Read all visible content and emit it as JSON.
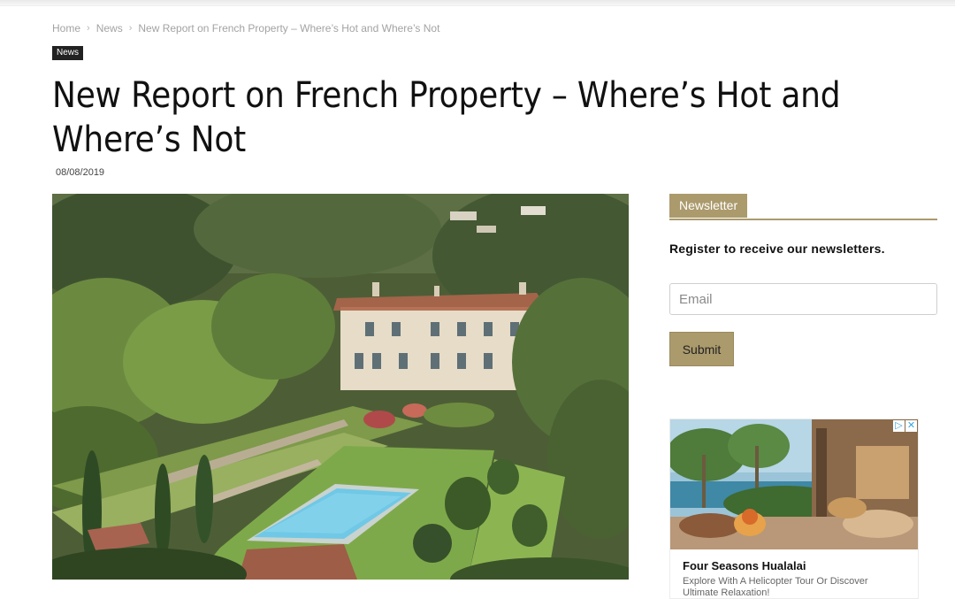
{
  "breadcrumb": {
    "items": [
      "Home",
      "News",
      "New Report on French Property – Where’s Hot and Where’s Not"
    ],
    "separator": "›"
  },
  "category_badge": "News",
  "article": {
    "title": "New Report on French Property – Where’s Hot and Where’s Not",
    "date": "08/08/2019"
  },
  "newsletter": {
    "heading": "Newsletter",
    "prompt": "Register to receive our newsletters.",
    "email_placeholder": "Email",
    "submit_label": "Submit"
  },
  "ad": {
    "title": "Four Seasons Hualalai",
    "description": "Explore With A Helicopter Tour Or Discover Ultimate Relaxation!",
    "choices_icon": "adchoices-icon",
    "close_icon": "close-icon"
  },
  "colors": {
    "accent": "#ab9a6c",
    "badge_bg": "#222222",
    "breadcrumb_text": "#a3a3a3"
  }
}
